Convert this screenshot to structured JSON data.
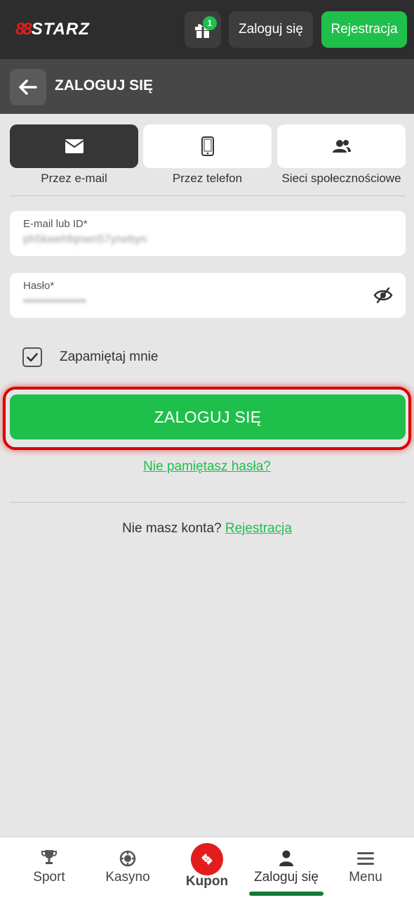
{
  "header": {
    "logo_mark": "88",
    "logo_text": "STARZ",
    "gift_badge": "1",
    "login_label": "Zaloguj się",
    "register_label": "Rejestracja"
  },
  "title_bar": {
    "title": "ZALOGUJ SIĘ"
  },
  "tabs": [
    {
      "label": "Przez e-mail",
      "icon": "envelope-icon",
      "active": true
    },
    {
      "label": "Przez telefon",
      "icon": "phone-icon",
      "active": false
    },
    {
      "label": "Sieci społecznościowe",
      "icon": "users-icon",
      "active": false
    }
  ],
  "form": {
    "email_label": "E-mail lub ID*",
    "email_value": "ph5kwehfqnwn57ynebyn",
    "password_label": "Hasło*",
    "password_value": "••••••••••••••••",
    "remember_label": "Zapamiętaj mnie",
    "remember_checked": true,
    "submit_label": "ZALOGUJ SIĘ",
    "forgot_label": "Nie pamiętasz hasła?",
    "no_account_text": "Nie masz konta?",
    "register_link": "Rejestracja"
  },
  "bottom_nav": [
    {
      "label": "Sport",
      "icon": "trophy-icon"
    },
    {
      "label": "Kasyno",
      "icon": "casino-chip-icon"
    },
    {
      "label": "Kupon",
      "icon": "ticket-icon"
    },
    {
      "label": "Zaloguj się",
      "icon": "user-icon",
      "active": true
    },
    {
      "label": "Menu",
      "icon": "hamburger-icon"
    }
  ],
  "colors": {
    "brand_green": "#1fbf4b",
    "brand_red": "#e31d1d",
    "header_bg": "#2d2d2d",
    "page_bg": "#e6e6e6"
  }
}
